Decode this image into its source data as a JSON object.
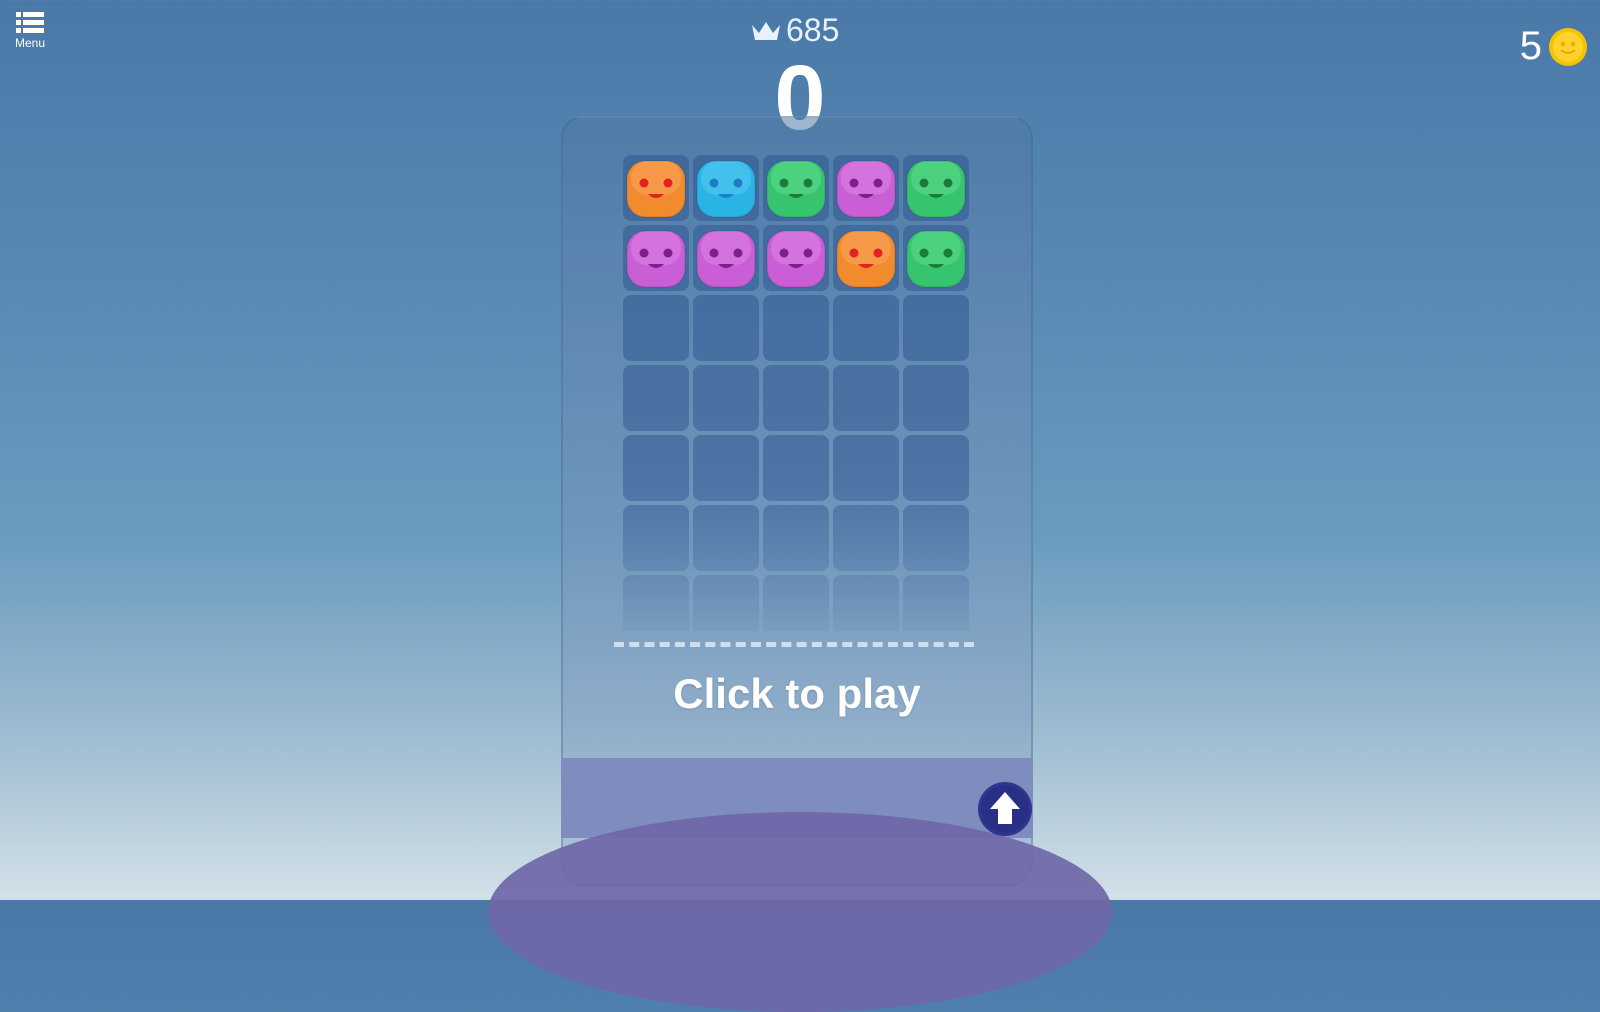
{
  "menu": {
    "label": "Menu",
    "icon": "menu-list-icon"
  },
  "best_score": {
    "icon": "crown-icon",
    "value": "685"
  },
  "score": {
    "value": "0"
  },
  "coins": {
    "count": "5",
    "icon": "smiley-coin-icon",
    "color": "#f5c400"
  },
  "board": {
    "columns": 5,
    "rows": 7,
    "pieces": [
      [
        "orange",
        "blue",
        "green",
        "purple",
        "green"
      ],
      [
        "purple",
        "purple",
        "purple",
        "orange",
        "green"
      ],
      [
        null,
        null,
        null,
        null,
        null
      ],
      [
        null,
        null,
        null,
        null,
        null
      ],
      [
        null,
        null,
        null,
        null,
        null
      ],
      [
        null,
        null,
        null,
        null,
        null
      ],
      [
        null,
        null,
        null,
        null,
        null
      ]
    ],
    "palette": {
      "orange": {
        "body": "#f28a2e",
        "light": "#f9a860",
        "eye": "#e52020",
        "mouth": "#e52020"
      },
      "blue": {
        "body": "#2ab4e6",
        "light": "#58ccf0",
        "eye": "#1c7ec4",
        "mouth": "#1c7ec4"
      },
      "green": {
        "body": "#37c46e",
        "light": "#5edc8e",
        "eye": "#1b7a3c",
        "mouth": "#1b7a3c"
      },
      "purple": {
        "body": "#c95ed6",
        "light": "#dc85e6",
        "eye": "#7b1f8e",
        "mouth": "#7b1f8e"
      }
    }
  },
  "prompt": {
    "text": "Click to play"
  },
  "launch_button": {
    "icon": "arrow-up-icon",
    "color": "#2f3590"
  }
}
